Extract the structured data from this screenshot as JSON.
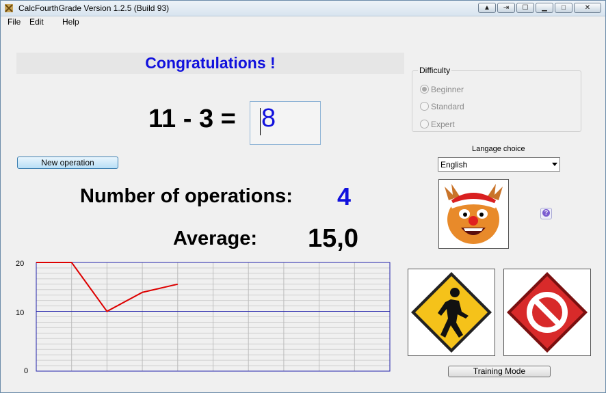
{
  "window": {
    "title": "CalcFourthGrade  Version 1.2.5 (Build 93)"
  },
  "menu": {
    "file": "File",
    "edit": "Edit",
    "help": "Help"
  },
  "banner": {
    "text": "Congratulations !"
  },
  "operation": {
    "expression": "11 - 3 =",
    "answer": "8"
  },
  "buttons": {
    "new_operation": "New operation",
    "training_mode": "Training Mode"
  },
  "stats": {
    "operations_label": "Number of operations:",
    "operations_value": "4",
    "average_label": "Average:",
    "average_value": "15,0"
  },
  "difficulty": {
    "legend": "Difficulty",
    "options": [
      "Beginner",
      "Standard",
      "Expert"
    ],
    "selected": "Beginner"
  },
  "language": {
    "label": "Langage choice",
    "selected": "English"
  },
  "icons": {
    "mascot": "reindeer-mascot-icon",
    "help": "help-icon",
    "start": "walk-sign-icon",
    "stop": "stop-sign-icon"
  },
  "colors": {
    "accent_text": "#1111dd",
    "chart_line": "#dd0000",
    "chart_axis": "#2222aa"
  },
  "chart_data": {
    "type": "line",
    "x": [
      1,
      2,
      3,
      4,
      5
    ],
    "y": [
      20,
      20,
      11,
      14.5,
      16
    ],
    "ylim": [
      0,
      20
    ],
    "y_ticks": [
      "20",
      "10",
      "0"
    ],
    "average_line": 11,
    "x_slots": 10,
    "grid": true
  }
}
